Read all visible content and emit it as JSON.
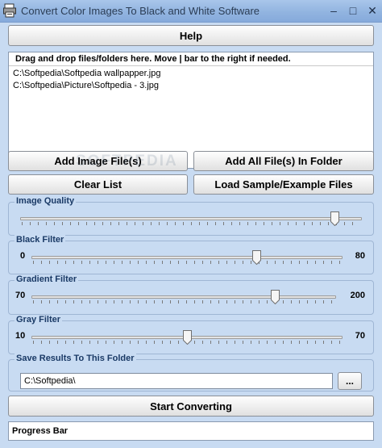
{
  "window": {
    "title": "Convert Color Images To Black and White Software",
    "minimize": "–",
    "maximize": "□",
    "close": "✕",
    "icon": "app-printer-icon"
  },
  "buttons": {
    "help": "Help",
    "add_image_files": "Add Image File(s)",
    "add_all_files_folder": "Add All File(s) In Folder",
    "clear_list": "Clear List",
    "load_sample": "Load Sample/Example Files",
    "start_converting": "Start Converting",
    "browse": "..."
  },
  "file_list": {
    "header": "Drag and drop files/folders here. Move | bar to the right if needed.",
    "files": [
      "C:\\Softpedia\\Softpedia wallpapper.jpg",
      "C:\\Softpedia\\Picture\\Softpedia - 3.jpg"
    ]
  },
  "watermark": "SOFTPEDIA",
  "sliders": {
    "image_quality": {
      "label": "Image Quality",
      "min": 0,
      "max": 100,
      "value": 92,
      "min_label": "",
      "max_label": ""
    },
    "black_filter": {
      "label": "Black Filter",
      "min": 0,
      "max": 80,
      "value": 58,
      "min_label": "0",
      "max_label": "80"
    },
    "gradient_filter": {
      "label": "Gradient Filter",
      "min": 70,
      "max": 200,
      "value": 174,
      "min_label": "70",
      "max_label": "200"
    },
    "gray_filter": {
      "label": "Gray Filter",
      "min": 10,
      "max": 70,
      "value": 40,
      "min_label": "10",
      "max_label": "70"
    }
  },
  "save_results": {
    "label": "Save Results To This Folder",
    "value": "C:\\Softpedia\\"
  },
  "progress": {
    "label": "Progress Bar",
    "value": 0
  },
  "colors": {
    "window_bg": "#c8dbf2",
    "group_label": "#1a3a66",
    "progress_fill": "#4f9a3c"
  }
}
